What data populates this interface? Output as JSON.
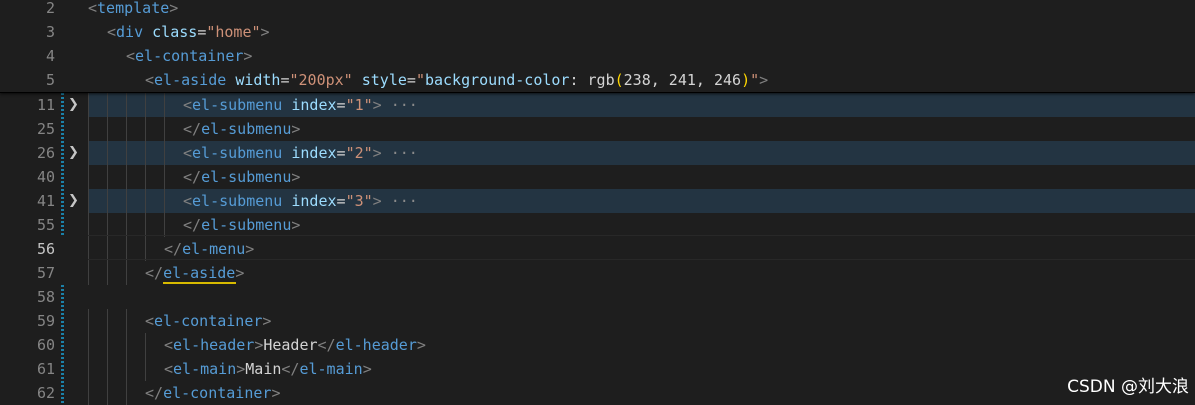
{
  "sticky_lines": [
    {
      "num": "2",
      "indent": 0,
      "tokens": [
        [
          "tag-bracket",
          "<"
        ],
        [
          "tag-name",
          "template"
        ],
        [
          "tag-bracket",
          ">"
        ]
      ]
    },
    {
      "num": "3",
      "indent": 1,
      "tokens": [
        [
          "tag-bracket",
          "<"
        ],
        [
          "tag-name",
          "div"
        ],
        [
          "punct",
          " "
        ],
        [
          "attr",
          "class"
        ],
        [
          "punct",
          "="
        ],
        [
          "str",
          "\"home\""
        ],
        [
          "tag-bracket",
          ">"
        ]
      ]
    },
    {
      "num": "4",
      "indent": 2,
      "tokens": [
        [
          "tag-bracket",
          "<"
        ],
        [
          "tag-name",
          "el-container"
        ],
        [
          "tag-bracket",
          ">"
        ]
      ]
    },
    {
      "num": "5",
      "indent": 3,
      "tokens": [
        [
          "tag-bracket",
          "<"
        ],
        [
          "tag-name",
          "el-aside"
        ],
        [
          "punct",
          " "
        ],
        [
          "attr",
          "width"
        ],
        [
          "punct",
          "="
        ],
        [
          "str",
          "\"200px\""
        ],
        [
          "punct",
          " "
        ],
        [
          "attr",
          "style"
        ],
        [
          "punct",
          "="
        ],
        [
          "str",
          "\""
        ],
        [
          "attr",
          "background-color"
        ],
        [
          "punct",
          ": rgb"
        ],
        [
          "paren",
          "("
        ],
        [
          "punct",
          "238, 241, 246"
        ],
        [
          "paren",
          ")"
        ],
        [
          "str",
          "\""
        ],
        [
          "tag-bracket",
          ">"
        ]
      ]
    }
  ],
  "lines": [
    {
      "num": "11",
      "indent": 5,
      "folded": true,
      "tokens": [
        [
          "tag-bracket",
          "<"
        ],
        [
          "tag-name",
          "el-submenu"
        ],
        [
          "punct",
          " "
        ],
        [
          "attr",
          "index"
        ],
        [
          "punct",
          "="
        ],
        [
          "str",
          "\"1\""
        ],
        [
          "tag-bracket",
          ">"
        ],
        [
          "ellipsis",
          " ···"
        ]
      ]
    },
    {
      "num": "25",
      "indent": 5,
      "folded": false,
      "tokens": [
        [
          "tag-bracket",
          "</"
        ],
        [
          "tag-name",
          "el-submenu"
        ],
        [
          "tag-bracket",
          ">"
        ]
      ]
    },
    {
      "num": "26",
      "indent": 5,
      "folded": true,
      "tokens": [
        [
          "tag-bracket",
          "<"
        ],
        [
          "tag-name",
          "el-submenu"
        ],
        [
          "punct",
          " "
        ],
        [
          "attr",
          "index"
        ],
        [
          "punct",
          "="
        ],
        [
          "str",
          "\"2\""
        ],
        [
          "tag-bracket",
          ">"
        ],
        [
          "ellipsis",
          " ···"
        ]
      ]
    },
    {
      "num": "40",
      "indent": 5,
      "folded": false,
      "tokens": [
        [
          "tag-bracket",
          "</"
        ],
        [
          "tag-name",
          "el-submenu"
        ],
        [
          "tag-bracket",
          ">"
        ]
      ]
    },
    {
      "num": "41",
      "indent": 5,
      "folded": true,
      "tokens": [
        [
          "tag-bracket",
          "<"
        ],
        [
          "tag-name",
          "el-submenu"
        ],
        [
          "punct",
          " "
        ],
        [
          "attr",
          "index"
        ],
        [
          "punct",
          "="
        ],
        [
          "str",
          "\"3\""
        ],
        [
          "tag-bracket",
          ">"
        ],
        [
          "ellipsis",
          " ···"
        ]
      ]
    },
    {
      "num": "55",
      "indent": 5,
      "folded": false,
      "tokens": [
        [
          "tag-bracket",
          "</"
        ],
        [
          "tag-name",
          "el-submenu"
        ],
        [
          "tag-bracket",
          ">"
        ]
      ]
    },
    {
      "num": "56",
      "indent": 4,
      "folded": false,
      "active": true,
      "tokens": [
        [
          "tag-bracket",
          "</"
        ],
        [
          "tag-name",
          "el-menu"
        ],
        [
          "tag-bracket",
          ">"
        ]
      ]
    },
    {
      "num": "57",
      "indent": 3,
      "folded": false,
      "tokens": [
        [
          "tag-bracket",
          "</"
        ],
        [
          "tag-name",
          "el-aside"
        ],
        [
          "tag-bracket",
          ">"
        ]
      ]
    },
    {
      "num": "58",
      "indent": 0,
      "folded": false,
      "tokens": []
    },
    {
      "num": "59",
      "indent": 3,
      "folded": false,
      "tokens": [
        [
          "tag-bracket",
          "<"
        ],
        [
          "tag-name",
          "el-container"
        ],
        [
          "tag-bracket",
          ">"
        ]
      ]
    },
    {
      "num": "60",
      "indent": 4,
      "folded": false,
      "tokens": [
        [
          "tag-bracket",
          "<"
        ],
        [
          "tag-name",
          "el-header"
        ],
        [
          "tag-bracket",
          ">"
        ],
        [
          "punct",
          "Header"
        ],
        [
          "tag-bracket",
          "</"
        ],
        [
          "tag-name",
          "el-header"
        ],
        [
          "tag-bracket",
          ">"
        ]
      ]
    },
    {
      "num": "61",
      "indent": 4,
      "folded": false,
      "tokens": [
        [
          "tag-bracket",
          "<"
        ],
        [
          "tag-name",
          "el-main"
        ],
        [
          "tag-bracket",
          ">"
        ],
        [
          "punct",
          "Main"
        ],
        [
          "tag-bracket",
          "</"
        ],
        [
          "tag-name",
          "el-main"
        ],
        [
          "tag-bracket",
          ">"
        ]
      ]
    },
    {
      "num": "62",
      "indent": 3,
      "folded": false,
      "tokens": [
        [
          "tag-bracket",
          "</"
        ],
        [
          "tag-name",
          "el-container"
        ],
        [
          "tag-bracket",
          ">"
        ]
      ]
    }
  ],
  "watermark": "CSDN @刘大浪"
}
